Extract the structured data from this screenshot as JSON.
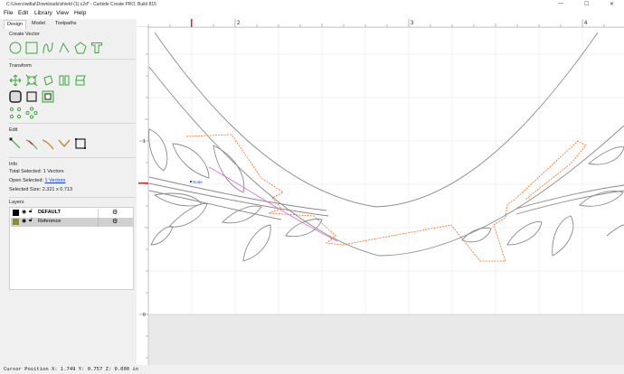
{
  "window": {
    "title": "C:\\Users\\wdlal\\Downloads\\shield (1).c2d* - Carbide Create PRO, Build 815",
    "controls": [
      "—",
      "☐",
      "✕"
    ]
  },
  "menu": [
    "File",
    "Edit",
    "Library",
    "View",
    "Help"
  ],
  "tabs": [
    "Design",
    "Model",
    "Toolpaths"
  ],
  "panel": {
    "create_vector": "Create Vector",
    "transform": "Transform",
    "edit": "Edit",
    "info": "Info",
    "total_selected_label": "Total Selected:",
    "total_selected_value": "1 Vectors",
    "open_selected_label": "Open Selected:",
    "open_selected_value": "1 Vectors",
    "selected_size_label": "Selected Size:",
    "selected_size_value": "2.321 x 0.713",
    "layers": "Layers"
  },
  "layers": [
    {
      "name": "DEFAULT",
      "color": "#000000",
      "selected": false
    },
    {
      "name": "Reference",
      "color": "#8a8a3a",
      "selected": true
    }
  ],
  "ruler": {
    "top_labels": [
      "2",
      "3",
      "4"
    ],
    "left_labels": [
      "1",
      "0"
    ]
  },
  "canvas": {
    "node_label": "Node"
  },
  "status": {
    "cursor": "Cursor Position X: 1.749 Y: 0.757 Z: 0.000 in"
  },
  "colors": {
    "accent_green": "#3aa83a",
    "toolpath_orange": "#ff6a1a",
    "selection_magenta": "#e26ae2",
    "ruler_marker": "#e02020"
  }
}
